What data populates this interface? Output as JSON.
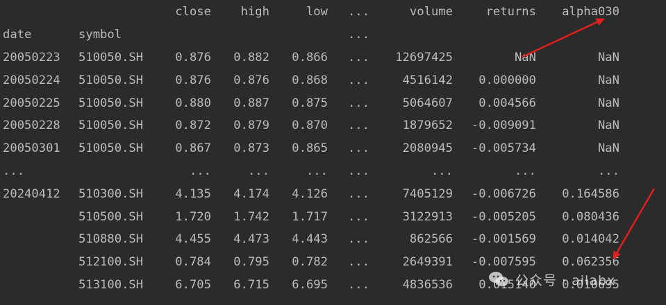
{
  "dataframe": {
    "columns": [
      "close",
      "high",
      "low",
      "...",
      "volume",
      "returns",
      "alpha030"
    ],
    "index_names": [
      "date",
      "symbol",
      "..."
    ],
    "rows": [
      {
        "date": "20050223",
        "symbol": "510050.SH",
        "close": "0.876",
        "high": "0.882",
        "low": "0.866",
        "ellipsis": "...",
        "volume": "12697425",
        "returns": "NaN",
        "alpha030": "NaN"
      },
      {
        "date": "20050224",
        "symbol": "510050.SH",
        "close": "0.876",
        "high": "0.876",
        "low": "0.868",
        "ellipsis": "...",
        "volume": "4516142",
        "returns": "0.000000",
        "alpha030": "NaN"
      },
      {
        "date": "20050225",
        "symbol": "510050.SH",
        "close": "0.880",
        "high": "0.887",
        "low": "0.875",
        "ellipsis": "...",
        "volume": "5064607",
        "returns": "0.004566",
        "alpha030": "NaN"
      },
      {
        "date": "20050228",
        "symbol": "510050.SH",
        "close": "0.872",
        "high": "0.879",
        "low": "0.870",
        "ellipsis": "...",
        "volume": "1879652",
        "returns": "-0.009091",
        "alpha030": "NaN"
      },
      {
        "date": "20050301",
        "symbol": "510050.SH",
        "close": "0.867",
        "high": "0.873",
        "low": "0.865",
        "ellipsis": "...",
        "volume": "2080945",
        "returns": "-0.005734",
        "alpha030": "NaN"
      },
      {
        "date": "...",
        "symbol": "",
        "close": "...",
        "high": "...",
        "low": "...",
        "ellipsis": "...",
        "volume": "...",
        "returns": "...",
        "alpha030": "..."
      },
      {
        "date": "20240412",
        "symbol": "510300.SH",
        "close": "4.135",
        "high": "4.174",
        "low": "4.126",
        "ellipsis": "...",
        "volume": "7405129",
        "returns": "-0.006726",
        "alpha030": "0.164586"
      },
      {
        "date": "",
        "symbol": "510500.SH",
        "close": "1.720",
        "high": "1.742",
        "low": "1.717",
        "ellipsis": "...",
        "volume": "3122913",
        "returns": "-0.005205",
        "alpha030": "0.080436"
      },
      {
        "date": "",
        "symbol": "510880.SH",
        "close": "4.455",
        "high": "4.473",
        "low": "4.443",
        "ellipsis": "...",
        "volume": "862566",
        "returns": "-0.001569",
        "alpha030": "0.014042"
      },
      {
        "date": "",
        "symbol": "512100.SH",
        "close": "0.784",
        "high": "0.795",
        "low": "0.782",
        "ellipsis": "...",
        "volume": "2649391",
        "returns": "-0.007595",
        "alpha030": "0.062356"
      },
      {
        "date": "",
        "symbol": "513100.SH",
        "close": "6.705",
        "high": "6.715",
        "low": "6.695",
        "ellipsis": "...",
        "volume": "4836536",
        "returns": "0.015140",
        "alpha030": "0.010695"
      }
    ]
  },
  "annotations": {
    "arrow_color": "#e0201c"
  },
  "watermark": {
    "text": "公众号 · ailabx",
    "icon": "wechat-icon"
  },
  "colors": {
    "background": "#2b2b2b",
    "text": "#bbbbbb"
  }
}
